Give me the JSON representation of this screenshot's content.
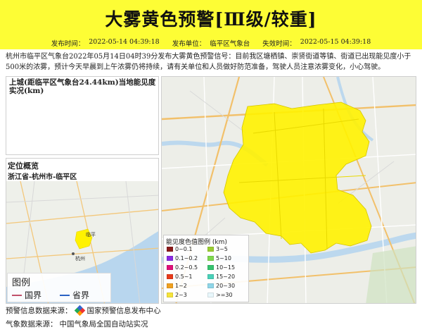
{
  "header": {
    "title": "大雾黄色预警[Ⅲ级/较重]"
  },
  "meta": {
    "publish_time_label": "发布时间：",
    "publish_time": "2022-05-14 04:39:18",
    "publisher_label": "发布单位：",
    "publisher": "临平区气象台",
    "expire_label": "失效时间：",
    "expire_time": "2022-05-15 04:39:18"
  },
  "description": "杭州市临平区气象台2022年05月14日04时39分发布大雾黄色预警信号：目前我区塘栖镇、崇贤街道等镇、街道已出现能见度小于500米的浓雾，预计今天早晨到上午浓雾仍将持续，请有关单位和人员做好防范准备，驾驶人员注意浓雾变化，小心驾驶。",
  "visibility_panel": {
    "title": "上城(距临平区气象台24.44km)当地能见度实况(km)"
  },
  "location_panel": {
    "heading": "定位概览",
    "path": "浙江省-杭州市-临平区",
    "map_label_1": "杭州",
    "map_label_2": "临平"
  },
  "small_legend": {
    "title": "图例",
    "national_border": "国界",
    "provincial_border": "省界",
    "national_color": "#c0506a",
    "provincial_color": "#2a62c4"
  },
  "visibility_legend": {
    "title": "能见度色值图例 (km)",
    "items": [
      {
        "label": "0~0.1",
        "color": "#8b1a1a"
      },
      {
        "label": "3~5",
        "color": "#9acd32"
      },
      {
        "label": "0.1~0.2",
        "color": "#8a2be2"
      },
      {
        "label": "5~10",
        "color": "#7fd84f"
      },
      {
        "label": "0.2~0.5",
        "color": "#e0107a"
      },
      {
        "label": "10~15",
        "color": "#36c36e"
      },
      {
        "label": "0.5~1",
        "color": "#e83a1a"
      },
      {
        "label": "15~20",
        "color": "#4ad1b8"
      },
      {
        "label": "1~2",
        "color": "#f0a020"
      },
      {
        "label": "20~30",
        "color": "#8fd6e8"
      },
      {
        "label": "2~3",
        "color": "#f5e33a"
      },
      {
        "label": ">=30",
        "color": "#e8f7fb"
      }
    ]
  },
  "footer": {
    "source_label": "预警信息数据来源：",
    "source_value": "国家预警信息发布中心",
    "weather_label": "气象数据来源：",
    "weather_value": "中国气象局全国自动站实况"
  },
  "colors": {
    "accent_yellow": "#fdfd35",
    "warning_fill": "#fff200"
  }
}
